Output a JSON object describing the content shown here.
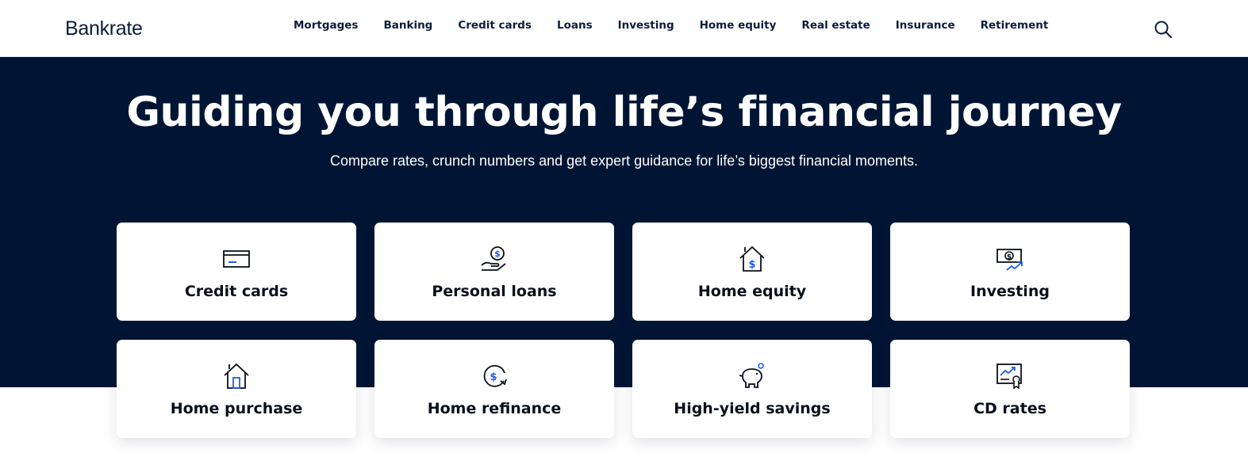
{
  "header": {
    "logo": "Bankrate",
    "nav": [
      "Mortgages",
      "Banking",
      "Credit cards",
      "Loans",
      "Investing",
      "Home equity",
      "Real estate",
      "Insurance",
      "Retirement"
    ],
    "search_icon": "search-icon"
  },
  "hero": {
    "title": "Guiding you through life’s financial journey",
    "subtitle": "Compare rates, crunch numbers and get expert guidance for life’s biggest financial moments."
  },
  "cards": [
    {
      "label": "Credit cards",
      "icon": "credit-card-icon"
    },
    {
      "label": "Personal loans",
      "icon": "hand-coin-icon"
    },
    {
      "label": "Home equity",
      "icon": "house-dollar-icon"
    },
    {
      "label": "Investing",
      "icon": "investing-icon"
    },
    {
      "label": "Home purchase",
      "icon": "house-door-icon"
    },
    {
      "label": "Home refinance",
      "icon": "refinance-icon"
    },
    {
      "label": "High-yield savings",
      "icon": "piggy-bank-icon"
    },
    {
      "label": "CD rates",
      "icon": "certificate-icon"
    }
  ],
  "colors": {
    "navy": "#001534",
    "accent_blue": "#1f5ce6",
    "text_dark": "#0a0f1c"
  }
}
